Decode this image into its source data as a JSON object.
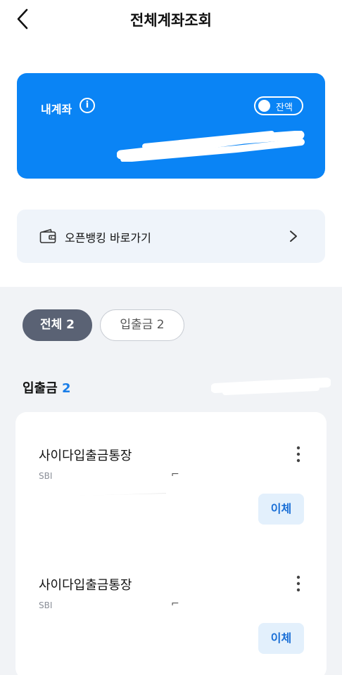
{
  "header": {
    "back_icon": "chevron-left-icon",
    "title": "전체계좌조회"
  },
  "account_card": {
    "label": "내계좌",
    "info_icon": "info-icon",
    "info_glyph": "i",
    "balance_toggle_label": "잔액",
    "balance_toggle_on": false,
    "background_color": "#0a84f5"
  },
  "open_banking": {
    "icon": "wallet-icon",
    "label": "오픈뱅킹 바로가기",
    "chevron_icon": "chevron-right-icon"
  },
  "filters": [
    {
      "label": "전체 2",
      "selected": true
    },
    {
      "label": "입출금 2",
      "selected": false
    }
  ],
  "section": {
    "title": "입출금",
    "count": "2"
  },
  "accounts": [
    {
      "name": "사이다입출금통장",
      "number_prefix": "SBI",
      "transfer_label": "이체",
      "menu_icon": "more-vertical-icon"
    },
    {
      "name": "사이다입출금통장",
      "number_prefix": "SBI",
      "transfer_label": "이체",
      "menu_icon": "more-vertical-icon"
    }
  ],
  "colors": {
    "accent_blue": "#1a7ee8",
    "pill_selected": "#5a6274",
    "section_bg": "#f1f3f6",
    "transfer_bg": "#e3f0fc"
  }
}
